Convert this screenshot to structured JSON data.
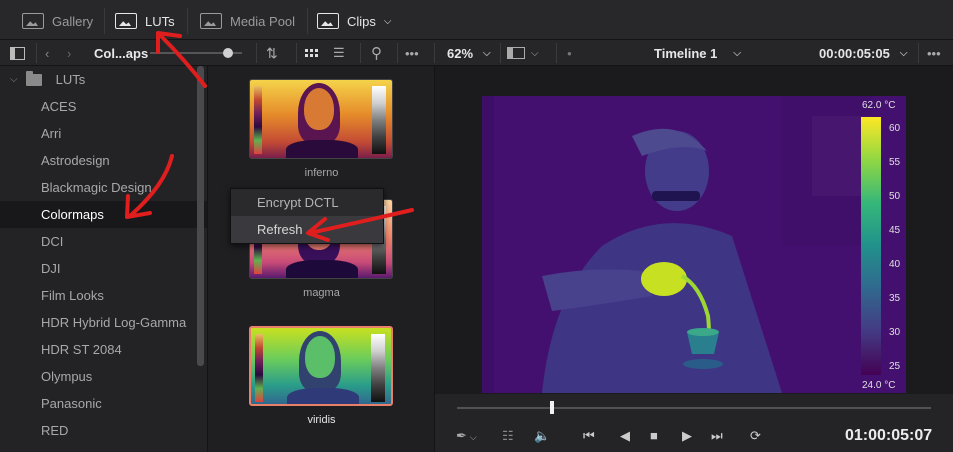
{
  "toolbar": {
    "gallery_label": "Gallery",
    "luts_label": "LUTs",
    "media_pool_label": "Media Pool",
    "clips_label": "Clips"
  },
  "lut_browser": {
    "path_label": "Col...aps",
    "root_label": "LUTs",
    "folders": [
      {
        "label": "ACES",
        "selected": false
      },
      {
        "label": "Arri",
        "selected": false
      },
      {
        "label": "Astrodesign",
        "selected": false
      },
      {
        "label": "Blackmagic Design",
        "selected": false
      },
      {
        "label": "Colormaps",
        "selected": true
      },
      {
        "label": "DCI",
        "selected": false
      },
      {
        "label": "DJI",
        "selected": false
      },
      {
        "label": "Film Looks",
        "selected": false
      },
      {
        "label": "HDR Hybrid Log-Gamma",
        "selected": false
      },
      {
        "label": "HDR ST 2084",
        "selected": false
      },
      {
        "label": "Olympus",
        "selected": false
      },
      {
        "label": "Panasonic",
        "selected": false
      },
      {
        "label": "RED",
        "selected": false
      }
    ],
    "thumbnails": [
      {
        "label": "inferno",
        "selected": false
      },
      {
        "label": "magma",
        "selected": false
      },
      {
        "label": "viridis",
        "selected": true
      }
    ]
  },
  "context_menu": {
    "items": [
      {
        "label": "Encrypt DCTL"
      },
      {
        "label": "Refresh"
      }
    ]
  },
  "viewer": {
    "zoom": "62%",
    "timeline_name": "Timeline 1",
    "timecode_top": "00:00:05:05",
    "colorbar_max": "62.0 °C",
    "colorbar_min": "24.0 °C",
    "colorbar_ticks": [
      "60",
      "55",
      "50",
      "45",
      "40",
      "35",
      "30",
      "25"
    ]
  },
  "transport": {
    "timecode": "01:00:05:07",
    "playhead_fraction": 0.2
  },
  "colors": {
    "selection_border": "#e8806a",
    "annotation": "#e01e1e"
  }
}
